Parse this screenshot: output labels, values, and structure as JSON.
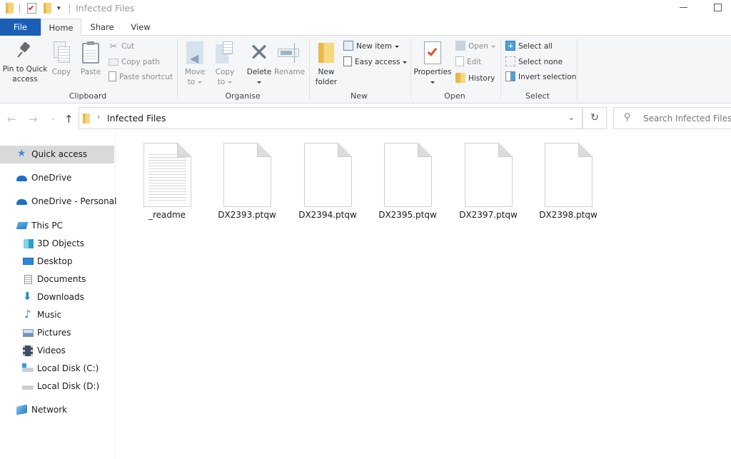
{
  "window": {
    "title": "Infected Files",
    "controls": {
      "minimize": "minimize",
      "maximize": "maximize"
    }
  },
  "quick_access_toolbar": {
    "icons": [
      "folder-icon",
      "properties-check-icon",
      "new-folder-icon",
      "customize-dropdown-icon"
    ]
  },
  "tabs": [
    {
      "label": "File",
      "active": false
    },
    {
      "label": "Home",
      "active": true
    },
    {
      "label": "Share",
      "active": false
    },
    {
      "label": "View",
      "active": false
    }
  ],
  "ribbon": {
    "clipboard": {
      "label": "Clipboard",
      "pin": "Pin to Quick access",
      "pin_l1": "Pin to Quick",
      "pin_l2": "access",
      "copy": "Copy",
      "paste": "Paste",
      "cut": "Cut",
      "copy_path": "Copy path",
      "paste_shortcut": "Paste shortcut"
    },
    "organise": {
      "label": "Organise",
      "move_to_l1": "Move",
      "move_to_l2": "to",
      "copy_to_l1": "Copy",
      "copy_to_l2": "to",
      "delete": "Delete",
      "rename": "Rename"
    },
    "new": {
      "label": "New",
      "new_folder_l1": "New",
      "new_folder_l2": "folder",
      "new_item": "New item",
      "easy_access": "Easy access"
    },
    "open": {
      "label": "Open",
      "properties": "Properties",
      "open": "Open",
      "edit": "Edit",
      "history": "History"
    },
    "select": {
      "label": "Select",
      "select_all": "Select all",
      "select_none": "Select none",
      "invert_selection": "Invert selection"
    }
  },
  "address_bar": {
    "path": [
      "Infected Files"
    ],
    "search_placeholder": "Search Infected Files"
  },
  "sidebar": {
    "items": [
      {
        "label": "Quick access",
        "icon": "star-icon",
        "selected": true
      },
      {
        "label": "OneDrive",
        "icon": "cloud-icon"
      },
      {
        "label": "OneDrive - Personal",
        "icon": "cloud-icon"
      },
      {
        "label": "This PC",
        "icon": "computer-icon"
      },
      {
        "label": "3D Objects",
        "icon": "cube-icon"
      },
      {
        "label": "Desktop",
        "icon": "desktop-icon"
      },
      {
        "label": "Documents",
        "icon": "document-icon"
      },
      {
        "label": "Downloads",
        "icon": "download-arrow-icon"
      },
      {
        "label": "Music",
        "icon": "music-note-icon"
      },
      {
        "label": "Pictures",
        "icon": "picture-icon"
      },
      {
        "label": "Videos",
        "icon": "film-icon"
      },
      {
        "label": "Local Disk (C:)",
        "icon": "system-drive-icon"
      },
      {
        "label": "Local Disk (D:)",
        "icon": "drive-icon"
      },
      {
        "label": "Network",
        "icon": "network-icon"
      }
    ]
  },
  "files": [
    {
      "name": "_readme",
      "type": "text"
    },
    {
      "name": "DX2393.ptqw",
      "type": "blank"
    },
    {
      "name": "DX2394.ptqw",
      "type": "blank"
    },
    {
      "name": "DX2395.ptqw",
      "type": "blank"
    },
    {
      "name": "DX2397.ptqw",
      "type": "blank"
    },
    {
      "name": "DX2398.ptqw",
      "type": "blank"
    }
  ],
  "colors": {
    "file_tab": "#1a5fb4",
    "selected_nav": "#d9d9d9",
    "folder": "#f5d478",
    "accent_blue": "#2b88d8"
  }
}
